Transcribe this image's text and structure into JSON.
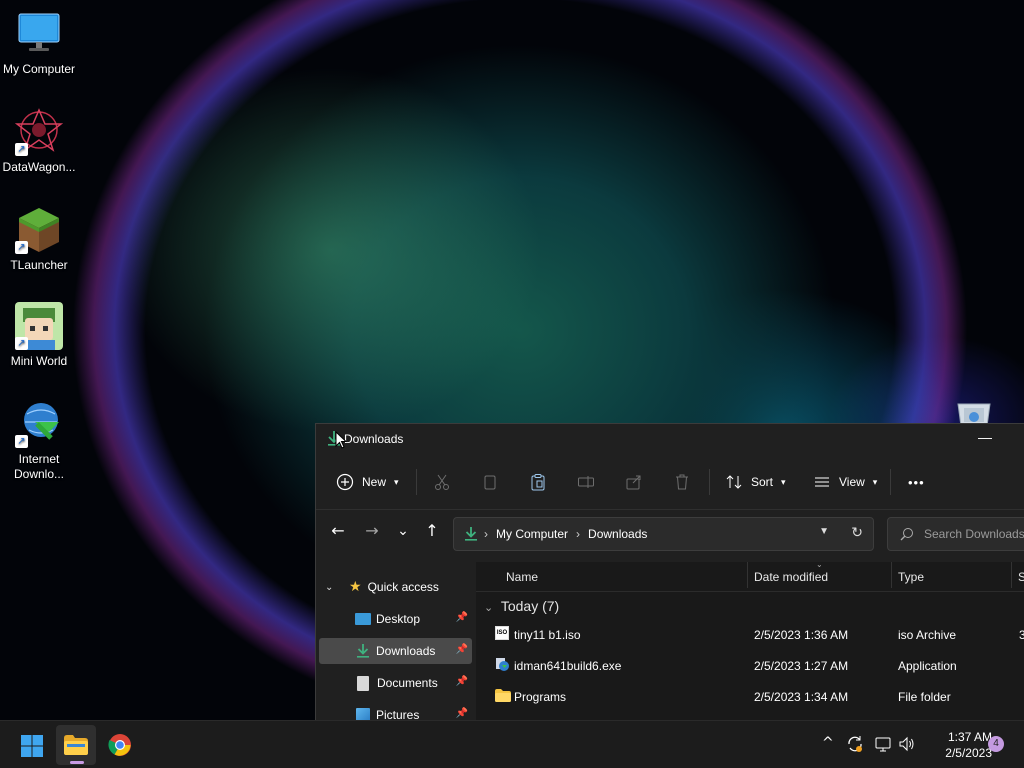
{
  "desktop": {
    "icons": [
      {
        "label": "My Computer"
      },
      {
        "label": "DataWagon..."
      },
      {
        "label": "TLauncher"
      },
      {
        "label": "Mini World"
      },
      {
        "label": "Internet",
        "label2": "Downlo..."
      }
    ]
  },
  "explorer": {
    "title": "Downloads",
    "minimize": "—",
    "toolbar": {
      "new_label": "New",
      "sort_label": "Sort",
      "view_label": "View",
      "more": "•••"
    },
    "nav": {
      "back": "←",
      "forward": "→",
      "recent": "⌄",
      "up": "↑"
    },
    "address": {
      "crumbs": [
        "My Computer",
        "Downloads"
      ],
      "separator": "›"
    },
    "search": {
      "placeholder": "Search Downloads"
    },
    "sidebar": {
      "items": [
        {
          "label": "Quick access"
        },
        {
          "label": "Desktop"
        },
        {
          "label": "Downloads"
        },
        {
          "label": "Documents"
        },
        {
          "label": "Pictures"
        }
      ]
    },
    "columns": [
      "Name",
      "Date modified",
      "Type",
      "S"
    ],
    "group_label": "Today (7)",
    "files": [
      {
        "name": "tiny11 b1.iso",
        "date": "2/5/2023 1:36 AM",
        "type": "iso Archive",
        "size": "3"
      },
      {
        "name": "idman641build6.exe",
        "date": "2/5/2023 1:27 AM",
        "type": "Application",
        "size": ""
      },
      {
        "name": "Programs",
        "date": "2/5/2023 1:34 AM",
        "type": "File folder",
        "size": ""
      }
    ]
  },
  "taskbar": {
    "time": "1:37 AM",
    "date": "2/5/2023",
    "notification_count": "4",
    "tray_chevron": "^"
  },
  "colors": {
    "accent_green": "#3fb27f",
    "folder_yellow": "#f5c542",
    "selection": "#4a4a4a",
    "notif_badge": "#c49ae0"
  }
}
